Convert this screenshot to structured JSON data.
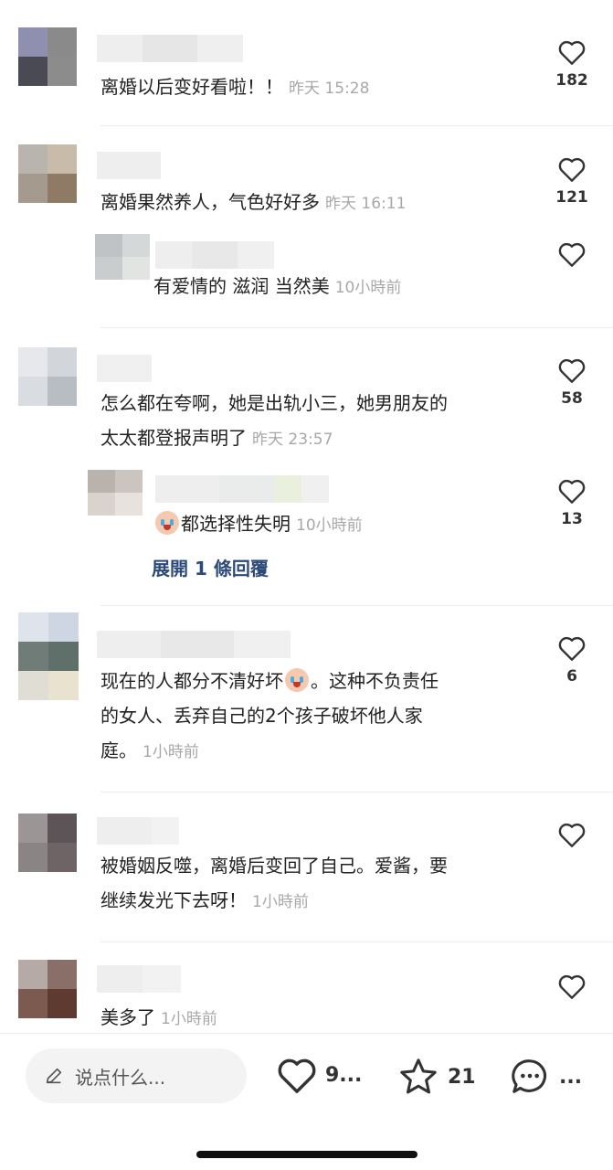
{
  "comments": [
    {
      "text": "离婚以后变好看啦！！",
      "time": "昨天 15:28",
      "likes": "182"
    },
    {
      "text": "离婚果然养人，气色好好多",
      "time": "昨天 16:11",
      "likes": "121"
    },
    {
      "text": "有爱情的 滋润 当然美",
      "time": "10小時前",
      "likes": ""
    },
    {
      "text_line1": "怎么都在夸啊，她是出轨小三，她男朋友的",
      "text_line2": "太太都登报声明了",
      "time": "昨天 23:57",
      "likes": "58"
    },
    {
      "text": "都选择性失明",
      "time": "10小時前",
      "likes": "13",
      "expand": "展開 1 條回覆"
    },
    {
      "text_line1a": "现在的人都分不清好坏",
      "text_line1b": "。这种不负责任",
      "text_line2": "的女人、丢弃自己的2个孩子破坏他人家",
      "text_line3": "庭。",
      "time": "1小時前",
      "likes": "6"
    },
    {
      "text_line1": "被婚姻反噬，离婚后变回了自己。爱酱，要",
      "text_line2": "继续发光下去呀！",
      "time": "1小時前",
      "likes": ""
    },
    {
      "text": "美多了",
      "time": "1小時前",
      "likes": ""
    }
  ],
  "bottom_bar": {
    "placeholder": "说点什么...",
    "like_count": "9...",
    "star_count": "21",
    "comment_label": "..."
  }
}
